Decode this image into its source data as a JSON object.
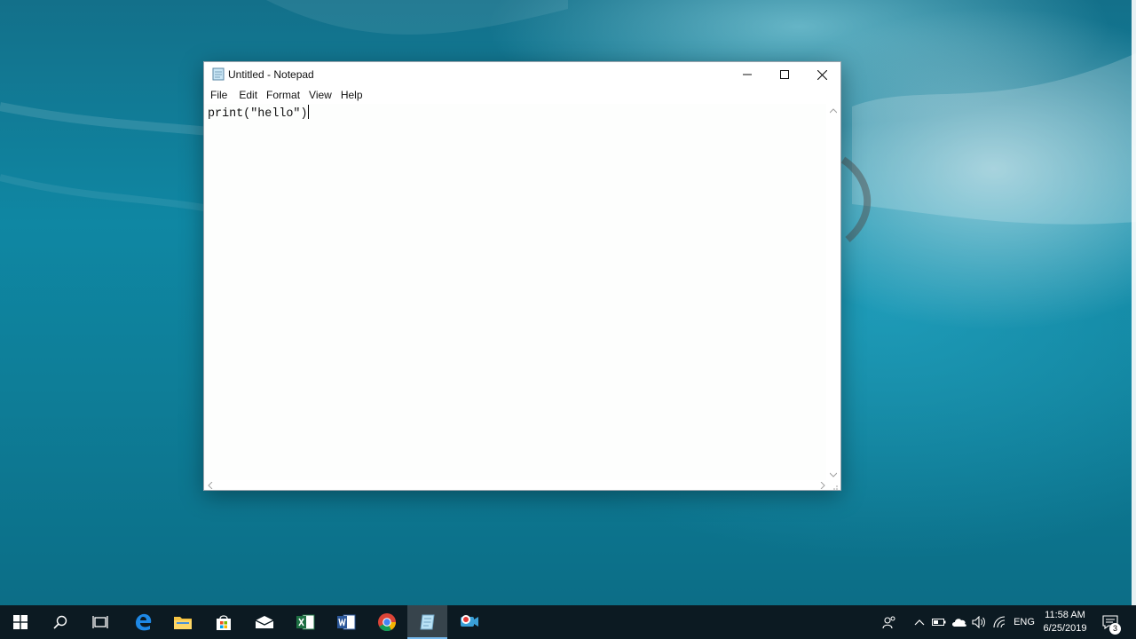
{
  "window": {
    "title": "Untitled - Notepad",
    "menu": [
      "File",
      "Edit",
      "Format",
      "View",
      "Help"
    ],
    "content": "print(\"hello\")"
  },
  "taskbar": {
    "apps": [
      {
        "name": "start",
        "icon": "windows-logo-icon"
      },
      {
        "name": "search",
        "icon": "search-icon"
      },
      {
        "name": "task-view",
        "icon": "task-view-icon"
      },
      {
        "name": "edge",
        "icon": "edge-icon"
      },
      {
        "name": "file-explorer",
        "icon": "folder-icon"
      },
      {
        "name": "store",
        "icon": "store-icon"
      },
      {
        "name": "mail",
        "icon": "mail-icon"
      },
      {
        "name": "excel",
        "icon": "excel-icon"
      },
      {
        "name": "word",
        "icon": "word-icon"
      },
      {
        "name": "chrome",
        "icon": "chrome-icon"
      },
      {
        "name": "notepad",
        "icon": "notepad-icon",
        "active": true
      },
      {
        "name": "recorder",
        "icon": "screen-recorder-icon"
      }
    ],
    "tray": {
      "language": "ENG",
      "time": "11:58 AM",
      "date": "6/25/2019",
      "notifications": "3"
    }
  },
  "colors": {
    "taskbar": "#0c1a22",
    "accent": "#76b9ed",
    "desktop": "#0f87a3"
  }
}
